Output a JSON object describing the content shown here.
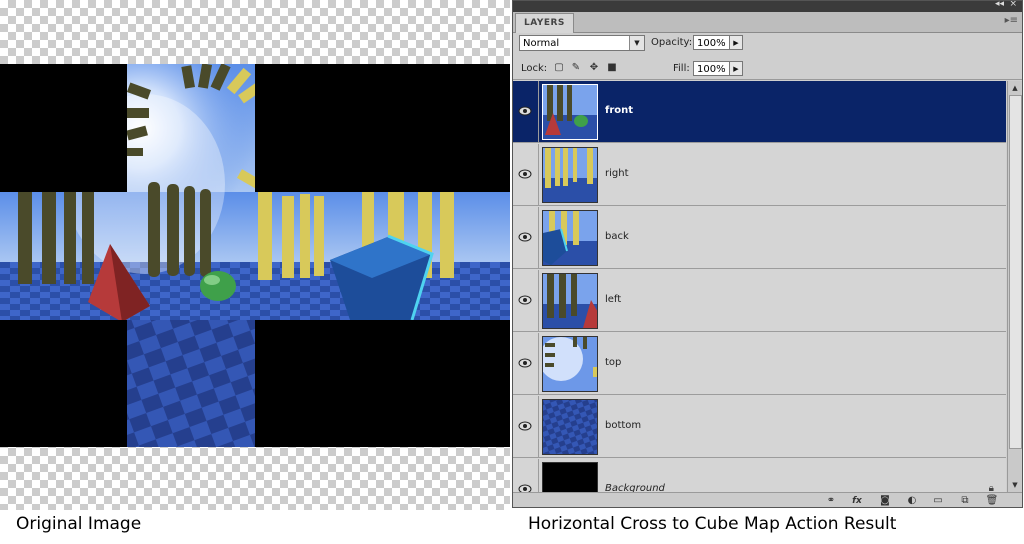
{
  "captions": {
    "left": "Original Image",
    "right": "Horizontal Cross to Cube Map Action Result"
  },
  "panel": {
    "tab_label": "LAYERS",
    "blend_mode": "Normal",
    "opacity_label": "Opacity:",
    "opacity_value": "100%",
    "lock_label": "Lock:",
    "fill_label": "Fill:",
    "fill_value": "100%",
    "layers": [
      {
        "name": "front",
        "selected": true,
        "visible": true
      },
      {
        "name": "right",
        "selected": false,
        "visible": true
      },
      {
        "name": "back",
        "selected": false,
        "visible": true
      },
      {
        "name": "left",
        "selected": false,
        "visible": true
      },
      {
        "name": "top",
        "selected": false,
        "visible": true
      },
      {
        "name": "bottom",
        "selected": false,
        "visible": true
      },
      {
        "name": "Background",
        "selected": false,
        "visible": true
      }
    ]
  },
  "colors": {
    "selection": "#0a2468",
    "panel_bg": "#cfcfcf"
  },
  "icons": [
    "link-icon",
    "fx-icon",
    "mask-icon",
    "adjustment-icon",
    "group-folder-icon",
    "new-layer-icon",
    "trash-icon",
    "eye-icon",
    "lock-icon",
    "panel-menu-icon"
  ]
}
